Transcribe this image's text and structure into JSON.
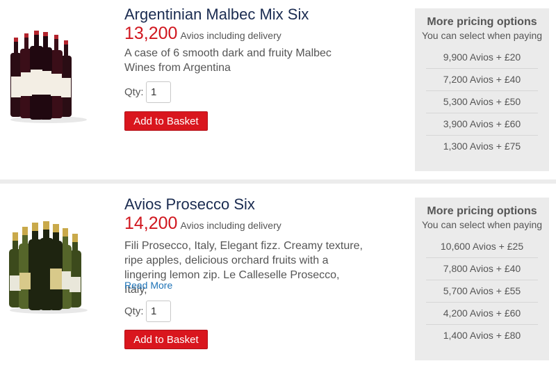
{
  "products": [
    {
      "title": "Argentinian Malbec Mix Six",
      "price": "13,200",
      "price_suffix": "Avios including delivery",
      "description": "A case of 6 smooth dark and fruity Malbec Wines from Argentina",
      "qty_label": "Qty:",
      "qty_value": "1",
      "add_label": "Add to Basket",
      "pricing_title": "More pricing options",
      "pricing_subtitle": "You can select when paying",
      "options": [
        "9,900 Avios + £20",
        "7,200 Avios + £40",
        "5,300 Avios + £50",
        "3,900 Avios + £60",
        "1,300 Avios + £75"
      ]
    },
    {
      "title": "Avios Prosecco Six",
      "price": "14,200",
      "price_suffix": "Avios including delivery",
      "description": "Fili Prosecco, Italy, Elegant fizz. Creamy texture, ripe apples, delicious orchard fruits with a lingering lemon zip. Le Calleselle Prosecco, Italy,",
      "read_more": "Read More",
      "qty_label": "Qty:",
      "qty_value": "1",
      "add_label": "Add to Basket",
      "pricing_title": "More pricing options",
      "pricing_subtitle": "You can select when paying",
      "options": [
        "10,600 Avios + £25",
        "7,800 Avios + £40",
        "5,700 Avios + £55",
        "4,200 Avios + £60",
        "1,400 Avios + £80"
      ]
    }
  ],
  "colors": {
    "price": "#d0161e",
    "button": "#d9161e",
    "title": "#1a2b50",
    "link": "#1e73b7",
    "panel": "#ebebeb"
  }
}
